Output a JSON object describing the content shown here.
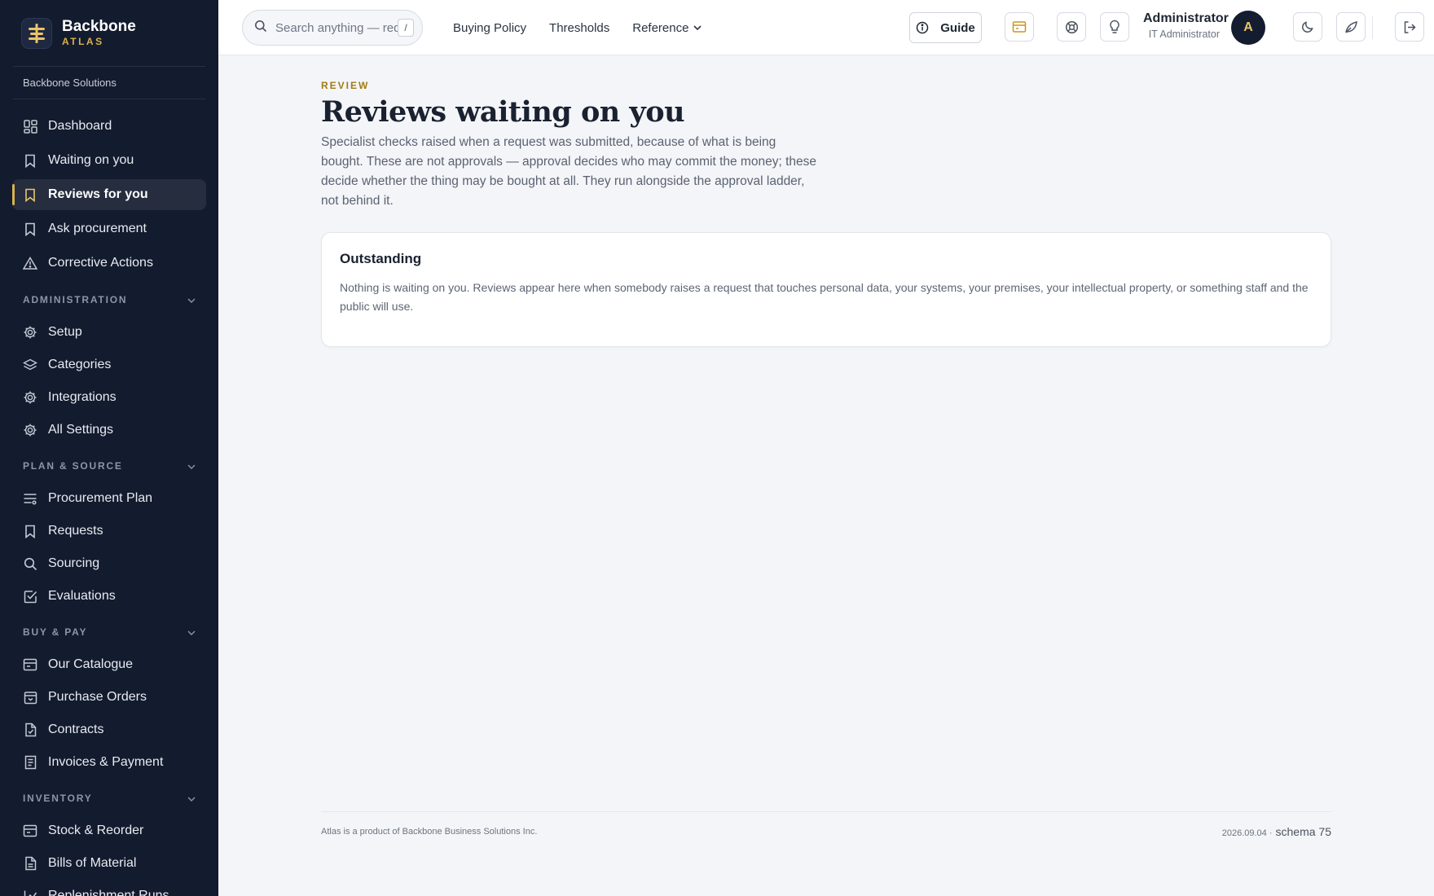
{
  "brand": {
    "name": "Backbone",
    "sub": "ATLAS",
    "org": "Backbone Solutions"
  },
  "sidebar": {
    "top_items": [
      {
        "label": "Dashboard",
        "icon": "dashboard-icon"
      },
      {
        "label": "Waiting on you",
        "icon": "bookmark-icon"
      },
      {
        "label": "Reviews for you",
        "icon": "bookmark-icon",
        "active": true
      },
      {
        "label": "Ask procurement",
        "icon": "bookmark-icon"
      },
      {
        "label": "Corrective Actions",
        "icon": "warning-icon"
      }
    ],
    "sections": [
      {
        "title": "ADMINISTRATION",
        "items": [
          "Setup",
          "Categories",
          "Integrations",
          "All Settings"
        ]
      },
      {
        "title": "PLAN & SOURCE",
        "items": [
          "Procurement Plan",
          "Requests",
          "Sourcing",
          "Evaluations"
        ]
      },
      {
        "title": "BUY & PAY",
        "items": [
          "Our Catalogue",
          "Purchase Orders",
          "Contracts",
          "Invoices & Payment"
        ]
      },
      {
        "title": "INVENTORY",
        "items": [
          "Stock & Reorder",
          "Bills of Material",
          "Replenishment Runs"
        ]
      }
    ]
  },
  "topbar": {
    "search_placeholder": "Search anything — req",
    "search_shortcut": "/",
    "links": [
      "Buying Policy",
      "Thresholds",
      "Reference"
    ],
    "guide_label": "Guide",
    "user_name": "Administrator",
    "user_role": "IT Administrator",
    "avatar_initial": "A"
  },
  "main": {
    "eyebrow": "REVIEW",
    "title": "Reviews waiting on you",
    "lede": "Specialist checks raised when a request was submitted, because of what is being bought. These are not approvals — approval decides who may commit the money; these decide whether the thing may be bought at all. They run alongside the approval ladder, not behind it.",
    "card": {
      "title": "Outstanding",
      "text": "Nothing is waiting on you. Reviews appear here when somebody raises a request that touches personal data, your systems, your premises, your intellectual property, or something staff and the public will use."
    }
  },
  "footer": {
    "left": "Atlas is a product of Backbone Business Solutions Inc.",
    "version": "2026.09.04 ·",
    "schema": "schema 75"
  },
  "colors": {
    "sidebar_bg": "#131b2e",
    "accent": "#d9b24c",
    "eyebrow": "#a27b15"
  }
}
